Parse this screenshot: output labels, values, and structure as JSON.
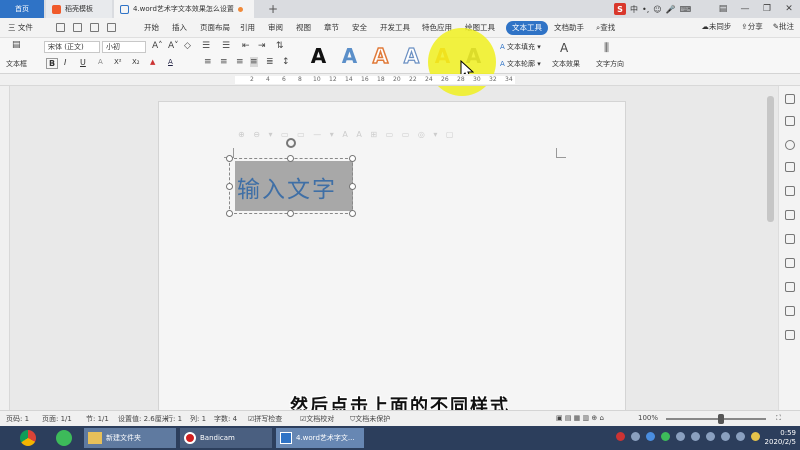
{
  "tabs": {
    "home": "首页",
    "template": "稻壳模板",
    "document": "4.word艺术字文本效果怎么设置",
    "add": "+"
  },
  "ime": {
    "logo": "S",
    "mode": "中"
  },
  "menu": {
    "file": "三 文件",
    "items": [
      "开始",
      "插入",
      "页面布局",
      "引用",
      "审阅",
      "视图",
      "章节",
      "安全",
      "开发工具",
      "特色应用",
      "绘图工具",
      "文本工具",
      "文档助手"
    ],
    "search": "查找",
    "sync": "未同步",
    "share": "分享",
    "comment": "批注"
  },
  "ribbon": {
    "textbox_label": "文本框",
    "font_name": "宋体 (正文)",
    "font_size": "小初",
    "bold": "B",
    "italic": "I",
    "underline": "U",
    "superscript": "X²",
    "subscript": "X₂",
    "wordart_letter": "A",
    "text_fill": "文本填充",
    "text_outline": "文本轮廓",
    "text_effect": "文本效果",
    "text_direction": "文字方向"
  },
  "ruler": {
    "numbers": [
      "2",
      "4",
      "6",
      "8",
      "10",
      "12",
      "14",
      "16",
      "18",
      "20",
      "22",
      "24",
      "26",
      "28",
      "30",
      "32",
      "34"
    ]
  },
  "document": {
    "textbox_text": "输入文字",
    "ghost_toolbar": "⊕ ⊖ ▾ ▭ ▭ — ▾ A A ⊞ ▭ ▭ ◎ ▾ ▢"
  },
  "caption": "然后点击上面的不同样式",
  "status": {
    "page": "页码: 1",
    "pages": "页面: 1/1",
    "section": "节: 1/1",
    "setting": "设置值: 2.6厘米",
    "row": "行: 1",
    "col": "列: 1",
    "words": "字数: 4",
    "spell": "拼写检查",
    "proof": "文档校对",
    "protect": "文档未保护",
    "zoom": "100%"
  },
  "taskbar": {
    "folder": "新建文件夹",
    "bandicam": "Bandicam",
    "wps": "4.word艺术字文...",
    "time": "0:59",
    "date": "2020/2/5"
  },
  "colors": {
    "accent": "#2f73c6",
    "highlight": "#f0f01e",
    "wordart_text": "#3f6fa6",
    "taskbar": "#2c3e5c"
  }
}
